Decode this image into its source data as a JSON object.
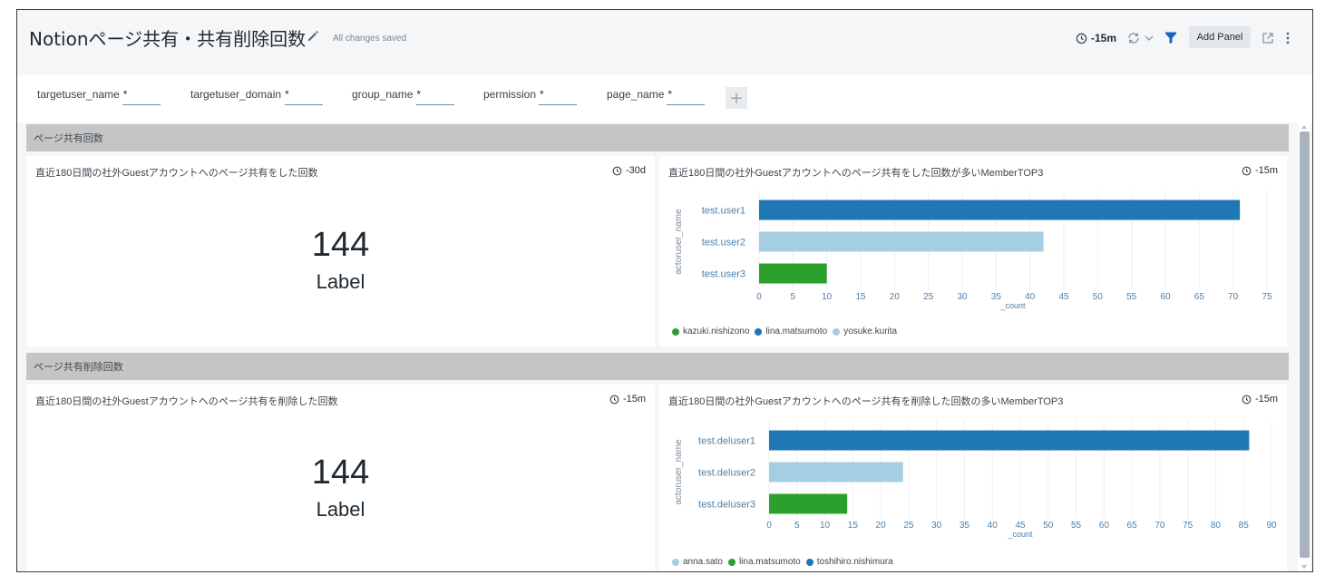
{
  "header": {
    "title": "Notionページ共有・共有削除回数",
    "saved_status": "All changes saved",
    "time_range": "-15m",
    "add_panel_label": "Add Panel"
  },
  "filters": [
    {
      "name": "targetuser_name",
      "required": "*"
    },
    {
      "name": "targetuser_domain",
      "required": "*"
    },
    {
      "name": "group_name",
      "required": "*"
    },
    {
      "name": "permission",
      "required": "*"
    },
    {
      "name": "page_name",
      "required": "*"
    }
  ],
  "add_filter_symbol": "+",
  "sections": [
    {
      "label": "ページ共有回数",
      "single_panel": {
        "title": "直近180日間の社外Guestアカウントへのページ共有をした回数",
        "time": "-30d",
        "value": "144",
        "value_label": "Label"
      },
      "chart_panel": {
        "title": "直近180日間の社外Guestアカウントへのページ共有をした回数が多いMemberTOP3",
        "time": "-15m"
      }
    },
    {
      "label": "ページ共有削除回数",
      "single_panel": {
        "title": "直近180日間の社外Guestアカウントへのページ共有を削除した回数",
        "time": "-15m",
        "value": "144",
        "value_label": "Label"
      },
      "chart_panel": {
        "title": "直近180日間の社外Guestアカウントへのページ共有を削除した回数の多いMemberTOP3",
        "time": "-15m"
      }
    }
  ],
  "colors": {
    "dark_blue": "#1f77b4",
    "light_blue": "#a6cee3",
    "green": "#2ca02c"
  },
  "chart_data": [
    {
      "type": "bar",
      "orientation": "horizontal",
      "categories": [
        "test.user1",
        "test.user2",
        "test.user3"
      ],
      "values": [
        71,
        42,
        10
      ],
      "bar_colors": [
        "#1f77b4",
        "#a6cee3",
        "#2ca02c"
      ],
      "xlabel": "_count",
      "ylabel": "actoruser_name",
      "xlim": [
        0,
        75
      ],
      "xticks": [
        0,
        5,
        10,
        15,
        20,
        25,
        30,
        35,
        40,
        45,
        50,
        55,
        60,
        65,
        70,
        75
      ],
      "grid": true,
      "legend": [
        {
          "name": "kazuki.nishizono",
          "color": "#2ca02c"
        },
        {
          "name": "lina.matsumoto",
          "color": "#1f77b4"
        },
        {
          "name": "yosuke.kurita",
          "color": "#a6cee3"
        }
      ],
      "legend_position": "bottom-left"
    },
    {
      "type": "bar",
      "orientation": "horizontal",
      "categories": [
        "test.deluser1",
        "test.deluser2",
        "test.deluser3"
      ],
      "values": [
        86,
        24,
        14
      ],
      "bar_colors": [
        "#1f77b4",
        "#a6cee3",
        "#2ca02c"
      ],
      "xlabel": "_count",
      "ylabel": "actoruser_name",
      "xlim": [
        0,
        90
      ],
      "xticks": [
        0,
        5,
        10,
        15,
        20,
        25,
        30,
        35,
        40,
        45,
        50,
        55,
        60,
        65,
        70,
        75,
        80,
        85,
        90
      ],
      "grid": true,
      "legend": [
        {
          "name": "anna.sato",
          "color": "#a6cee3"
        },
        {
          "name": "lina.matsumoto",
          "color": "#2ca02c"
        },
        {
          "name": "toshihiro.nishimura",
          "color": "#1f77b4"
        }
      ],
      "legend_position": "bottom-left"
    }
  ]
}
